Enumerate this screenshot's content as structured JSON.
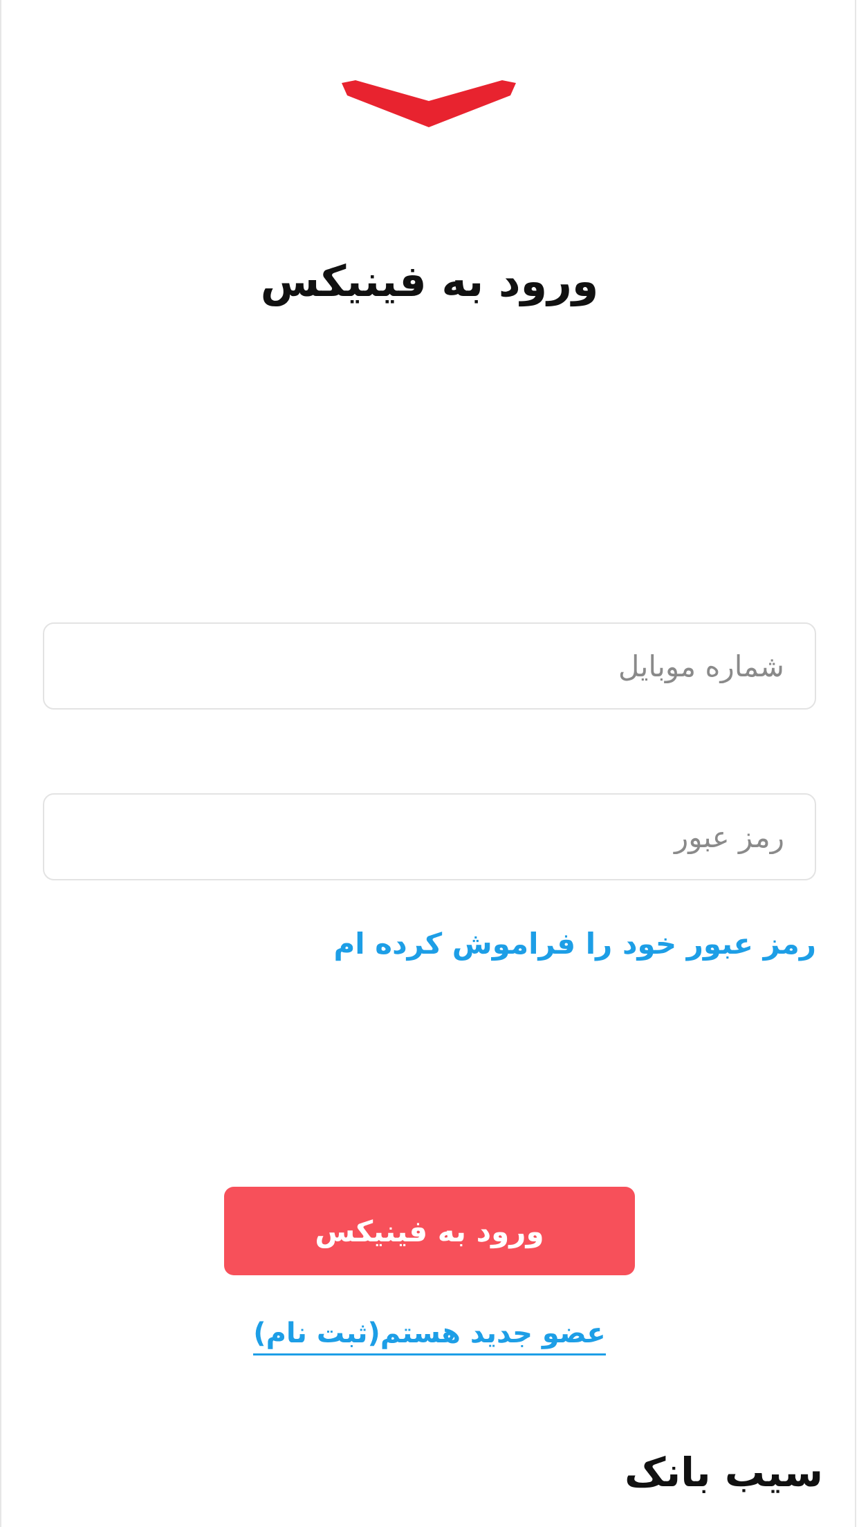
{
  "app": {
    "logo": "red-chevron-logo",
    "brand_color": "#e8232f"
  },
  "login": {
    "title": "ورود به فینیکس",
    "mobile_placeholder": "شماره موبایل",
    "mobile_value": "",
    "password_placeholder": "رمز عبور",
    "password_value": "",
    "forgot_password": "رمز عبور خود را فراموش کرده ام",
    "submit_label": "ورود به فینیکس",
    "register_label": "عضو جدید هستم(ثبت نام)"
  },
  "footer": {
    "watermark": "سیب بانک"
  },
  "colors": {
    "accent_link": "#1d9ee6",
    "button": "#f7505a",
    "field_border": "#e3e3e3"
  }
}
